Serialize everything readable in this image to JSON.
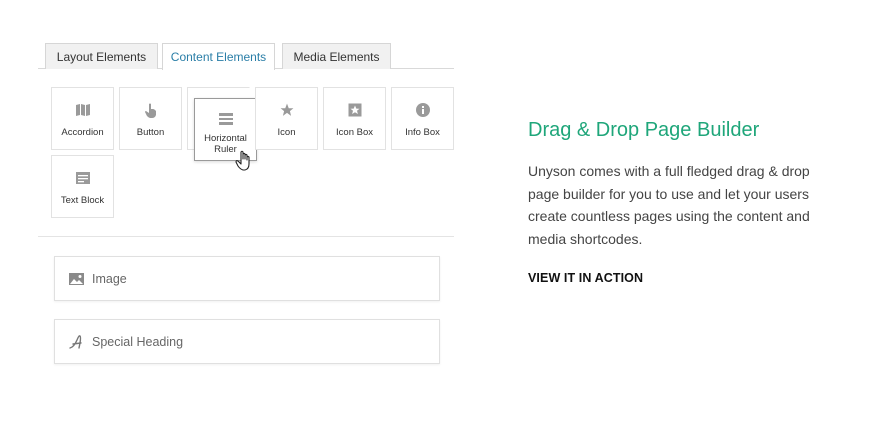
{
  "tabs": [
    {
      "label": "Layout Elements",
      "active": false
    },
    {
      "label": "Content Elements",
      "active": true
    },
    {
      "label": "Media Elements",
      "active": false
    }
  ],
  "tiles": [
    {
      "label": "Accordion",
      "icon": "map-icon"
    },
    {
      "label": "Button",
      "icon": "pointer-hand-icon"
    },
    {
      "label": "Horizontal Ruler",
      "icon": "horizontal-ruler-icon"
    },
    {
      "label": "Icon",
      "icon": "star-icon"
    },
    {
      "label": "Icon Box",
      "icon": "star-box-icon"
    },
    {
      "label": "Info Box",
      "icon": "info-circle-icon"
    },
    {
      "label": "Text Block",
      "icon": "text-lines-icon"
    }
  ],
  "builder_items": [
    {
      "label": "Image",
      "icon": "image-icon"
    },
    {
      "label": "Special Heading",
      "icon": "script-a-icon"
    }
  ],
  "feature": {
    "title": "Drag & Drop Page Builder",
    "description": "Unyson comes with a full fledged drag & drop page builder for you to use and let your users create countless pages using the content and media shortcodes.",
    "cta": "VIEW IT IN ACTION"
  },
  "colors": {
    "accent_green": "#1fa67a",
    "tab_active_text": "#2a7ea7",
    "icon_gray": "#9a9a9a"
  }
}
